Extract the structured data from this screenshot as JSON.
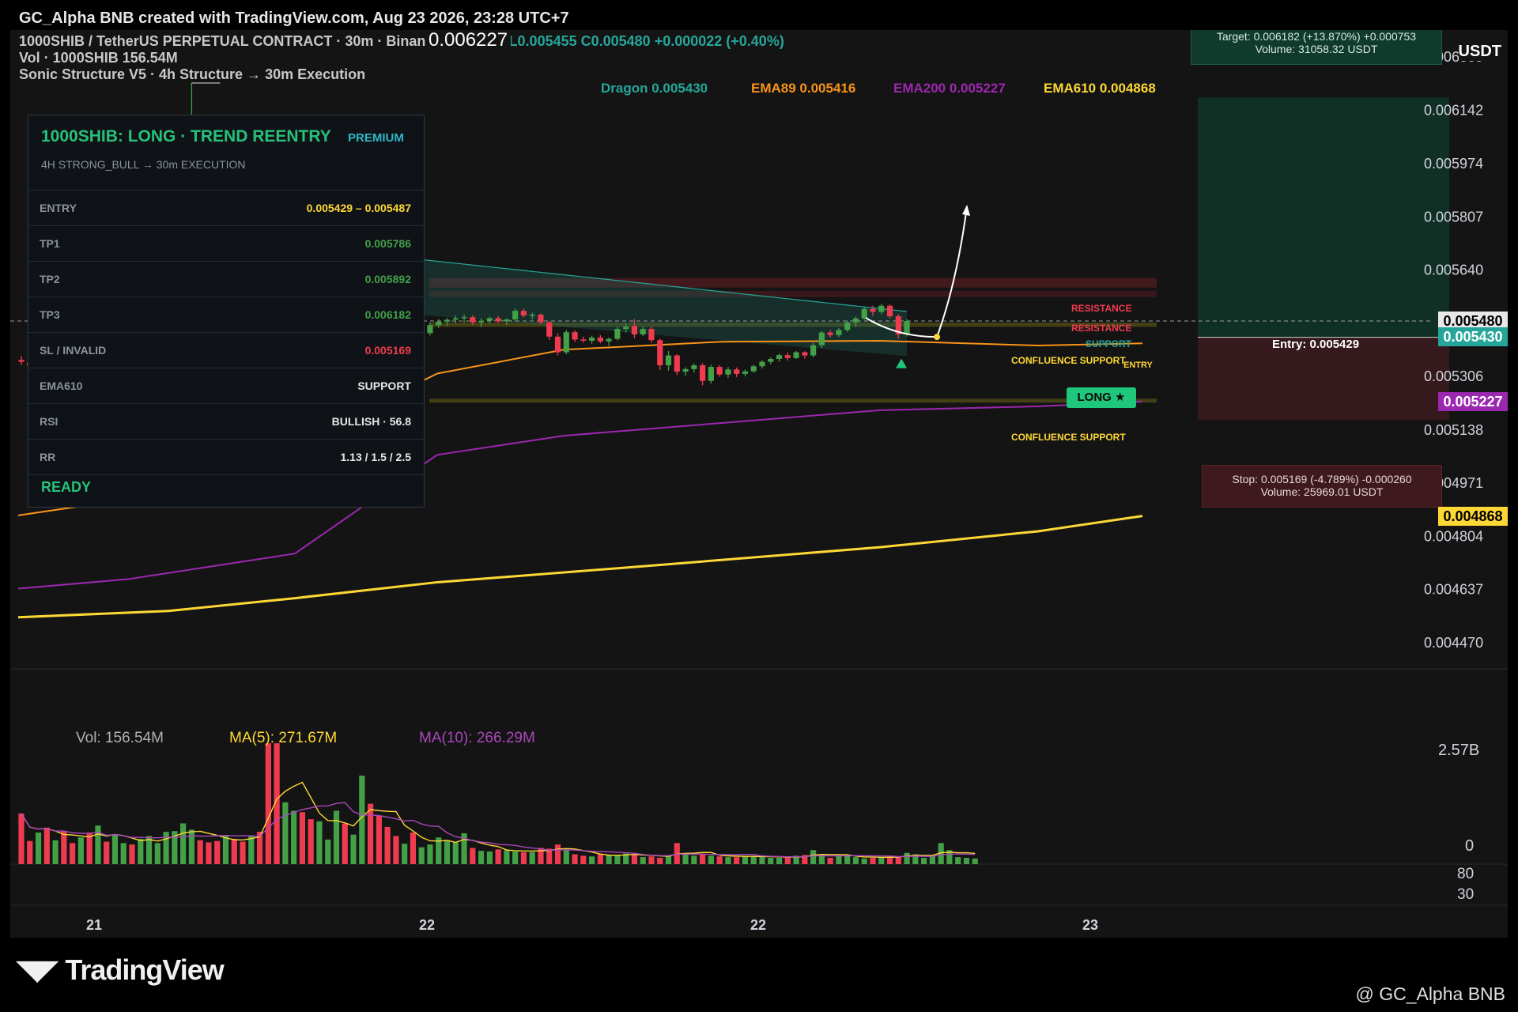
{
  "header": {
    "title": "GC_Alpha BNB created with TradingView.com, Aug 23 2026, 23:28 UTC+7"
  },
  "legend": {
    "symbol": "1000SHIB / TetherUS PERPETUAL CONTRACT · 30m · Binance",
    "ohlc": "0.005470 L0.005455 C0.005480 +0.000022 (+0.40%)",
    "high_marker": "0.006227",
    "vol": "Vol · 1000SHIB  156.54M",
    "indicator": "Sonic Structure V5 · 4h Structure → 30m Execution"
  },
  "ema_legend": [
    {
      "label": "Dragon 0.005430",
      "color": "#26a69a"
    },
    {
      "label": "EMA89 0.005416",
      "color": "#f7931a"
    },
    {
      "label": "EMA200 0.005227",
      "color": "#9c27b0"
    },
    {
      "label": "EMA610 0.004868",
      "color": "#fdd835"
    }
  ],
  "signal_panel": {
    "title": "1000SHIB: LONG · TREND REENTRY",
    "badge": "PREMIUM",
    "subtitle": "4H STRONG_BULL → 30m EXECUTION",
    "rows": [
      {
        "label": "ENTRY",
        "value": "0.005429 – 0.005487",
        "color": "#fdd835"
      },
      {
        "label": "TP1",
        "value": "0.005786",
        "color": "#43a047"
      },
      {
        "label": "TP2",
        "value": "0.005892",
        "color": "#43a047"
      },
      {
        "label": "TP3",
        "value": "0.006182",
        "color": "#43a047"
      },
      {
        "label": "SL / INVALID",
        "value": "0.005169",
        "color": "#ef3b4f"
      },
      {
        "label": "EMA610",
        "value": "SUPPORT",
        "color": "#e6e6e6"
      },
      {
        "label": "RSI",
        "value": "BULLISH · 56.8",
        "color": "#e6e6e6"
      },
      {
        "label": "RR",
        "value": "1.13 / 1.5 / 2.5",
        "color": "#e6e6e6"
      }
    ],
    "status": "READY"
  },
  "target_box": {
    "line1": "Target: 0.006182  (+13.870%)  +0.000753",
    "line2": "Volume: 31058.32 USDT"
  },
  "stop_box": {
    "line1": "Stop: 0.005169  (-4.789%)  -0.000260",
    "line2": "Volume: 25969.01 USDT"
  },
  "entry_label": "Entry: 0.005429",
  "price_tags": [
    {
      "text": "0.005480",
      "value": 0.00548,
      "bg": "#e8e8e8",
      "fg": "#000000"
    },
    {
      "text": "0.005430",
      "value": 0.00543,
      "bg": "#26a69a",
      "fg": "#ffffff"
    },
    {
      "text": "0.005227",
      "value": 0.005227,
      "bg": "#9c27b0",
      "fg": "#ffffff"
    },
    {
      "text": "0.004868",
      "value": 0.004868,
      "bg": "#fdd835",
      "fg": "#000000"
    }
  ],
  "annotations": {
    "resistance": "RESISTANCE",
    "support": "SUPPORT",
    "confluence_support": "CONFLUENCE SUPPORT",
    "entry": "ENTRY",
    "long": "LONG ★"
  },
  "volume_legend": {
    "vol": "Vol: 156.54M",
    "ma5": "MA(5): 271.67M",
    "ma10": "MA(10): 266.29M"
  },
  "volume_axis": [
    "2.57B",
    "0"
  ],
  "rsi_axis": [
    "80",
    "30"
  ],
  "currency_label": "USDT",
  "footer": {
    "logo": "TradingView",
    "author": "@ GC_Alpha BNB"
  },
  "chart_data": {
    "type": "candlestick",
    "symbol": "1000SHIB/USDT Perpetual",
    "timeframe": "30m",
    "y_ticks": [
      0.006309,
      0.006142,
      0.005974,
      0.005807,
      0.00564,
      0.005306,
      0.005138,
      0.004971,
      0.004804,
      0.004637,
      0.00447
    ],
    "ylim": [
      0.00447,
      0.006309
    ],
    "x_ticks": [
      "21",
      "22",
      "22",
      "23"
    ],
    "high_marker": 0.006227,
    "entry_zone": [
      0.005429,
      0.005487
    ],
    "stop": 0.005169,
    "target": 0.006182,
    "take_profits": [
      0.005786,
      0.005892,
      0.006182
    ],
    "ema": {
      "dragon": 0.00543,
      "ema89": 0.005416,
      "ema200": 0.005227,
      "ema610": 0.004868
    },
    "last_close": 0.00548,
    "candles": [
      [
        0.005358,
        0.00537,
        0.005342,
        0.005352
      ],
      [
        0.00535,
        0.005355,
        0.005332,
        0.00534
      ],
      [
        0.00534,
        0.00535,
        0.00533,
        0.005345
      ],
      [
        0.005342,
        0.005348,
        0.005328,
        0.005336
      ],
      [
        0.005336,
        0.005352,
        0.00533,
        0.005347
      ],
      [
        0.005347,
        0.005355,
        0.005335,
        0.00534
      ],
      [
        0.005344,
        0.005346,
        0.005328,
        0.005334
      ],
      [
        0.005334,
        0.005342,
        0.005325,
        0.005338
      ],
      [
        0.00534,
        0.005348,
        0.005332,
        0.005336
      ],
      [
        0.005338,
        0.005344,
        0.005326,
        0.005341
      ],
      [
        0.00534,
        0.005346,
        0.005334,
        0.005338
      ],
      [
        0.005336,
        0.005343,
        0.00533,
        0.00534
      ],
      [
        0.005342,
        0.005348,
        0.005336,
        0.005345
      ],
      [
        0.005346,
        0.005352,
        0.00534,
        0.005343
      ],
      [
        0.005346,
        0.005356,
        0.00534,
        0.005351
      ],
      [
        0.005352,
        0.005362,
        0.005345,
        0.005358
      ],
      [
        0.005358,
        0.005366,
        0.00535,
        0.005362
      ],
      [
        0.005364,
        0.005375,
        0.005356,
        0.005371
      ],
      [
        0.005373,
        0.005385,
        0.005365,
        0.005381
      ],
      [
        0.005385,
        0.00562,
        0.005378,
        0.00561
      ],
      [
        0.00562,
        0.006227,
        0.005596,
        0.005961
      ],
      [
        0.005962,
        0.005982,
        0.005742,
        0.005758
      ],
      [
        0.00576,
        0.005779,
        0.005694,
        0.005706
      ],
      [
        0.005705,
        0.005716,
        0.005638,
        0.005652
      ],
      [
        0.005652,
        0.005742,
        0.00563,
        0.005728
      ],
      [
        0.005728,
        0.005744,
        0.005688,
        0.005696
      ],
      [
        0.005696,
        0.005701,
        0.005615,
        0.005622
      ],
      [
        0.005622,
        0.005756,
        0.005614,
        0.005744
      ],
      [
        0.005744,
        0.005754,
        0.005666,
        0.005674
      ],
      [
        0.005676,
        0.005685,
        0.005545,
        0.005555
      ],
      [
        0.005555,
        0.005563,
        0.005402,
        0.005418
      ],
      [
        0.005418,
        0.005462,
        0.005405,
        0.005452
      ],
      [
        0.005452,
        0.005508,
        0.00544,
        0.005492
      ],
      [
        0.005492,
        0.005519,
        0.005465,
        0.005472
      ],
      [
        0.00547,
        0.005482,
        0.005416,
        0.005428
      ],
      [
        0.00543,
        0.005462,
        0.005421,
        0.005444
      ],
      [
        0.005445,
        0.005512,
        0.005438,
        0.005505
      ],
      [
        0.005505,
        0.005527,
        0.00548,
        0.005518
      ],
      [
        0.005516,
        0.00552,
        0.005465,
        0.005475
      ],
      [
        0.005475,
        0.005492,
        0.005462,
        0.005488
      ],
      [
        0.005488,
        0.005516,
        0.005478,
        0.005505
      ],
      [
        0.005505,
        0.005514,
        0.005464,
        0.005471
      ],
      [
        0.005471,
        0.005484,
        0.005449,
        0.005458
      ],
      [
        0.005458,
        0.005468,
        0.005436,
        0.005444
      ],
      [
        0.005444,
        0.005452,
        0.005398,
        0.005406
      ],
      [
        0.005406,
        0.005432,
        0.005391,
        0.005412
      ],
      [
        0.005412,
        0.005419,
        0.005394,
        0.005401
      ],
      [
        0.005401,
        0.005448,
        0.005397,
        0.005442
      ],
      [
        0.005442,
        0.005475,
        0.005435,
        0.005467
      ],
      [
        0.005467,
        0.005486,
        0.005459,
        0.005478
      ],
      [
        0.005478,
        0.00549,
        0.005465,
        0.005484
      ],
      [
        0.005484,
        0.005497,
        0.005472,
        0.005489
      ],
      [
        0.005489,
        0.005501,
        0.005475,
        0.005492
      ],
      [
        0.005492,
        0.005498,
        0.005468,
        0.005476
      ],
      [
        0.005476,
        0.005488,
        0.005461,
        0.005481
      ],
      [
        0.005481,
        0.005493,
        0.005472,
        0.005489
      ],
      [
        0.005489,
        0.005496,
        0.005474,
        0.005479
      ],
      [
        0.005479,
        0.005488,
        0.005468,
        0.005485
      ],
      [
        0.005485,
        0.005519,
        0.005478,
        0.005512
      ],
      [
        0.005512,
        0.005519,
        0.005491,
        0.005497
      ],
      [
        0.005497,
        0.005506,
        0.005485,
        0.0055
      ],
      [
        0.0055,
        0.005504,
        0.005471,
        0.005476
      ],
      [
        0.005476,
        0.00548,
        0.005421,
        0.005431
      ],
      [
        0.005431,
        0.005442,
        0.005372,
        0.005382
      ],
      [
        0.005382,
        0.005452,
        0.005376,
        0.005445
      ],
      [
        0.005445,
        0.005451,
        0.005414,
        0.005422
      ],
      [
        0.005422,
        0.005431,
        0.005412,
        0.005418
      ],
      [
        0.005418,
        0.005434,
        0.005409,
        0.005428
      ],
      [
        0.005428,
        0.005436,
        0.00541,
        0.005416
      ],
      [
        0.005416,
        0.005428,
        0.005402,
        0.005424
      ],
      [
        0.005424,
        0.005462,
        0.005419,
        0.005455
      ],
      [
        0.005455,
        0.005473,
        0.005444,
        0.005462
      ],
      [
        0.005464,
        0.005486,
        0.005426,
        0.005438
      ],
      [
        0.005438,
        0.005462,
        0.005432,
        0.005455
      ],
      [
        0.005455,
        0.005462,
        0.005412,
        0.00542
      ],
      [
        0.00542,
        0.005425,
        0.005326,
        0.005341
      ],
      [
        0.005341,
        0.005386,
        0.005324,
        0.005372
      ],
      [
        0.005372,
        0.005376,
        0.005311,
        0.005321
      ],
      [
        0.005321,
        0.005335,
        0.005308,
        0.005329
      ],
      [
        0.005329,
        0.005347,
        0.005318,
        0.005341
      ],
      [
        0.005341,
        0.005347,
        0.005278,
        0.005292
      ],
      [
        0.005292,
        0.005342,
        0.005284,
        0.005336
      ],
      [
        0.005336,
        0.005342,
        0.005305,
        0.005312
      ],
      [
        0.005312,
        0.005336,
        0.005302,
        0.005328
      ],
      [
        0.005328,
        0.005334,
        0.005304,
        0.005314
      ],
      [
        0.005314,
        0.005328,
        0.005306,
        0.005322
      ],
      [
        0.005322,
        0.005343,
        0.005318,
        0.005338
      ],
      [
        0.005338,
        0.005357,
        0.005331,
        0.005352
      ],
      [
        0.005352,
        0.005365,
        0.005344,
        0.005361
      ],
      [
        0.005361,
        0.005378,
        0.005352,
        0.005373
      ],
      [
        0.005373,
        0.005381,
        0.005356,
        0.005364
      ],
      [
        0.005364,
        0.005386,
        0.005361,
        0.005382
      ],
      [
        0.005382,
        0.005385,
        0.005362,
        0.005372
      ],
      [
        0.005372,
        0.005412,
        0.005366,
        0.005404
      ],
      [
        0.005404,
        0.005448,
        0.005396,
        0.005444
      ],
      [
        0.005444,
        0.005452,
        0.005428,
        0.005436
      ],
      [
        0.005436,
        0.005458,
        0.00543,
        0.005452
      ],
      [
        0.005452,
        0.005482,
        0.005446,
        0.005476
      ],
      [
        0.005476,
        0.005494,
        0.005462,
        0.005488
      ],
      [
        0.005488,
        0.005524,
        0.005483,
        0.005518
      ],
      [
        0.005518,
        0.005528,
        0.005496,
        0.005509
      ],
      [
        0.005509,
        0.005534,
        0.005502,
        0.005528
      ],
      [
        0.005528,
        0.005532,
        0.005488,
        0.005495
      ],
      [
        0.005495,
        0.005501,
        0.005425,
        0.005438
      ],
      [
        0.005438,
        0.005486,
        0.005432,
        0.00548
      ]
    ],
    "volume": [
      0.72,
      0.33,
      0.45,
      0.52,
      0.34,
      0.47,
      0.3,
      0.38,
      0.45,
      0.55,
      0.32,
      0.41,
      0.3,
      0.28,
      0.36,
      0.4,
      0.3,
      0.46,
      0.47,
      0.58,
      0.49,
      0.34,
      0.31,
      0.33,
      0.4,
      0.36,
      0.32,
      0.41,
      0.46,
      1.72,
      1.72,
      0.88,
      0.76,
      0.74,
      0.64,
      0.61,
      0.35,
      0.76,
      0.58,
      0.42,
      1.26,
      0.86,
      0.69,
      0.53,
      0.4,
      0.29,
      0.45,
      0.24,
      0.28,
      0.38,
      0.34,
      0.31,
      0.44,
      0.23,
      0.19,
      0.18,
      0.21,
      0.2,
      0.18,
      0.17,
      0.17,
      0.23,
      0.22,
      0.28,
      0.21,
      0.14,
      0.12,
      0.11,
      0.14,
      0.13,
      0.13,
      0.15,
      0.14,
      0.1,
      0.11,
      0.09,
      0.12,
      0.3,
      0.15,
      0.12,
      0.14,
      0.12,
      0.11,
      0.1,
      0.1,
      0.12,
      0.12,
      0.1,
      0.09,
      0.09,
      0.1,
      0.12,
      0.13,
      0.2,
      0.14,
      0.09,
      0.12,
      0.12,
      0.1,
      0.08,
      0.09,
      0.1,
      0.12,
      0.11,
      0.16,
      0.14,
      0.09,
      0.12,
      0.3,
      0.2,
      0.1,
      0.09,
      0.08
    ]
  }
}
